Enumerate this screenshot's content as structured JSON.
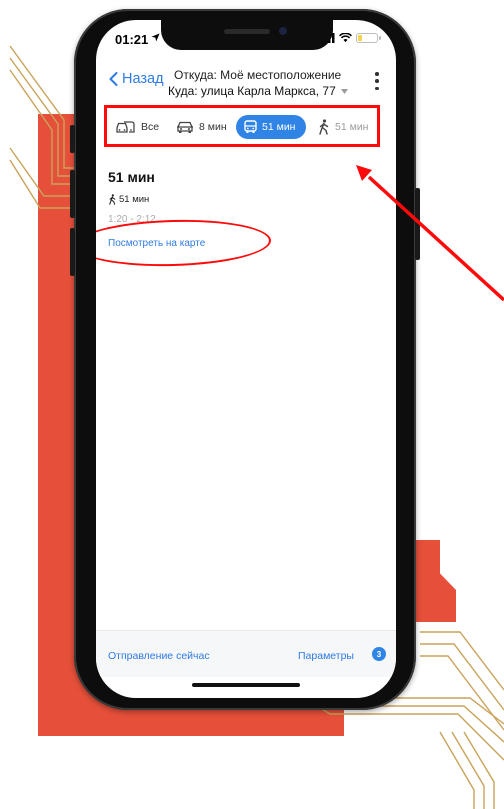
{
  "colors": {
    "accent": "#2f7be2",
    "active_tab": "#2f84e6",
    "highlight": "#ff0a0a",
    "deco_orange": "#e6503a",
    "deco_line": "#c9a35a"
  },
  "status": {
    "time": "01:21",
    "battery_level": 0.25
  },
  "header": {
    "back_label": "Назад",
    "from": "Откуда: Моё местоположение",
    "to": "Куда: улица Карла Маркса, 77"
  },
  "tabs": [
    {
      "label": "Все",
      "icon": "car-transit-icon"
    },
    {
      "label": "8 мин",
      "icon": "car-icon"
    },
    {
      "label": "51 мин",
      "icon": "bus-icon",
      "active": true
    },
    {
      "label": "51 мин",
      "icon": "walk-icon"
    }
  ],
  "route": {
    "title": "51 мин",
    "walk_time": "51 мин",
    "time_range": "1:20 - 2:12",
    "map_link": "Посмотреть на карте"
  },
  "bottom": {
    "depart": "Отправление сейчас",
    "params": "Параметры",
    "params_count": "3"
  }
}
